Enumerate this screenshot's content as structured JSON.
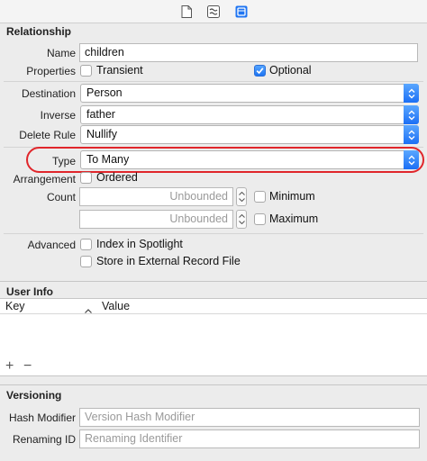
{
  "toolbar": {
    "icons": [
      "file-icon",
      "history-icon",
      "data-model-icon"
    ]
  },
  "relationship": {
    "section_title": "Relationship",
    "name_label": "Name",
    "name_value": "children",
    "properties_label": "Properties",
    "transient_label": "Transient",
    "transient_checked": false,
    "optional_label": "Optional",
    "optional_checked": true,
    "destination_label": "Destination",
    "destination_value": "Person",
    "inverse_label": "Inverse",
    "inverse_value": "father",
    "delete_rule_label": "Delete Rule",
    "delete_rule_value": "Nullify",
    "type_label": "Type",
    "type_value": "To Many",
    "arrangement_label": "Arrangement",
    "ordered_label": "Ordered",
    "ordered_checked": false,
    "count_label": "Count",
    "min_placeholder": "Unbounded",
    "max_placeholder": "Unbounded",
    "minimum_label": "Minimum",
    "maximum_label": "Maximum",
    "advanced_label": "Advanced",
    "index_spotlight_label": "Index in Spotlight",
    "external_record_label": "Store in External Record File"
  },
  "user_info": {
    "section_title": "User Info",
    "columns": [
      "Key",
      "Value"
    ],
    "sort_indicator": "^",
    "add_label": "+",
    "remove_label": "−"
  },
  "versioning": {
    "section_title": "Versioning",
    "hash_modifier_label": "Hash Modifier",
    "hash_modifier_placeholder": "Version Hash Modifier",
    "renaming_id_label": "Renaming ID",
    "renaming_id_placeholder": "Renaming Identifier"
  },
  "colors": {
    "accent": "#1e74f2",
    "highlight_annotation": "#e0262b",
    "panel_bg": "#ececec"
  }
}
